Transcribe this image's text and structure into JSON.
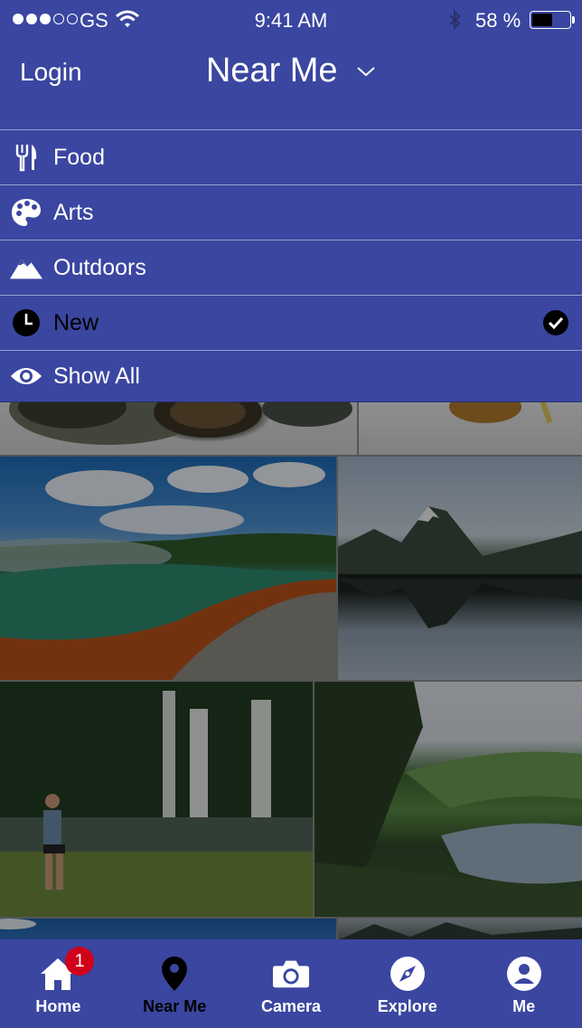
{
  "status_bar": {
    "carrier": "GS",
    "time": "9:41 AM",
    "battery": "58 %",
    "battery_level": 0.58,
    "signal_bars_filled": 3,
    "signal_bars_total": 5
  },
  "header": {
    "login_label": "Login",
    "title": "Near Me"
  },
  "menu": {
    "items": [
      {
        "label": "Food",
        "icon": "fork-knife-icon",
        "selected": false
      },
      {
        "label": "Arts",
        "icon": "palette-icon",
        "selected": false
      },
      {
        "label": "Outdoors",
        "icon": "mountain-icon",
        "selected": false
      },
      {
        "label": "New",
        "icon": "clock-icon",
        "selected": true
      },
      {
        "label": "Show All",
        "icon": "eye-icon",
        "selected": false
      }
    ]
  },
  "photos": [
    {
      "subject": "seafood plate"
    },
    {
      "subject": "plate of food"
    },
    {
      "subject": "hot spring with orange rim"
    },
    {
      "subject": "mountain reflected in lake"
    },
    {
      "subject": "waterfall with hiker"
    },
    {
      "subject": "green valley with river"
    },
    {
      "subject": "blue sky"
    },
    {
      "subject": "dark landscape"
    }
  ],
  "tabbar": {
    "items": [
      {
        "label": "Home",
        "icon": "home-icon",
        "badge": "1",
        "active": false
      },
      {
        "label": "Near Me",
        "icon": "map-pin-icon",
        "badge": "",
        "active": true
      },
      {
        "label": "Camera",
        "icon": "camera-icon",
        "badge": "",
        "active": false
      },
      {
        "label": "Explore",
        "icon": "compass-icon",
        "badge": "",
        "active": false
      },
      {
        "label": "Me",
        "icon": "user-icon",
        "badge": "",
        "active": false
      }
    ]
  },
  "colors": {
    "brand": "#3a46a0",
    "badge": "#d0021b",
    "active_tab": "#000000"
  }
}
